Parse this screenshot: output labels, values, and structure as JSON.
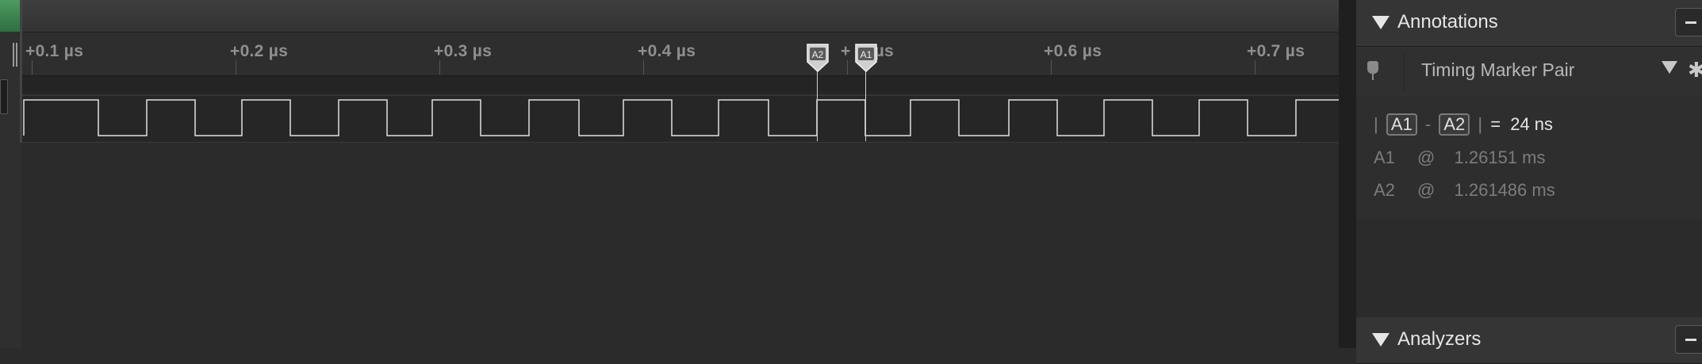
{
  "timeline": {
    "ticks": [
      "+0.1 µs",
      "+0.2 µs",
      "+0.3 µs",
      "+0.4 µs",
      "+0.5 µs",
      "+0.6 µs",
      "+0.7 µs"
    ],
    "occluded_tick_text": "+",
    "occluded_tick_unit": "µs"
  },
  "markers": {
    "a2_label": "A2",
    "a1_label": "A1"
  },
  "annotations_panel": {
    "title": "Annotations",
    "annotation_type": "Timing Marker Pair",
    "measurement": {
      "bar_left": "|",
      "a1_badge": "A1",
      "dash": "-",
      "a2_badge": "A2",
      "bar_right": "|",
      "equals": "=",
      "value": "24 ns"
    },
    "rows": [
      {
        "name": "A1",
        "at": "@",
        "time": "1.26151 ms"
      },
      {
        "name": "A2",
        "at": "@",
        "time": "1.261486 ms"
      }
    ]
  },
  "analyzers_panel": {
    "title": "Analyzers"
  }
}
